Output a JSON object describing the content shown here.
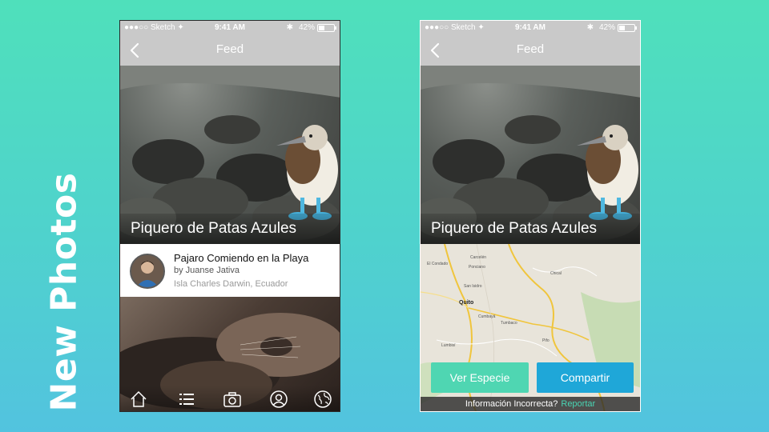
{
  "side_title": "New Photos",
  "status": {
    "carrier": "●●●○○ Sketch ✦",
    "time": "9:41 AM",
    "battery": "42%",
    "bluetooth": "✱"
  },
  "nav": {
    "title": "Feed",
    "back_icon": "chevron-left-icon"
  },
  "hero": {
    "caption": "Piquero de Patas Azules"
  },
  "post": {
    "title": "Pajaro Comiendo en la Playa",
    "by": "by Juanse Jativa",
    "location": "Isla Charles Darwin, Ecuador"
  },
  "tabs": [
    {
      "icon": "home-icon"
    },
    {
      "icon": "list-icon"
    },
    {
      "icon": "camera-icon"
    },
    {
      "icon": "profile-icon"
    },
    {
      "icon": "globe-icon"
    }
  ],
  "map": {
    "labels": [
      "El Condado",
      "Carcelén",
      "Ponciano",
      "San Isidro",
      "Quito",
      "Cumbayá",
      "Tumbaco",
      "Lumbisí",
      "Chical",
      "Pifo"
    ],
    "city": "Quito"
  },
  "actions": {
    "ver_especie": "Ver Especie",
    "compartir": "Compartir"
  },
  "footer": {
    "text": "Información Incorrecta?",
    "link": "Reportar"
  },
  "colors": {
    "accent_green": "#4fd6b2",
    "accent_blue": "#1fa7d8",
    "nav_gray": "#c9c9c9"
  }
}
